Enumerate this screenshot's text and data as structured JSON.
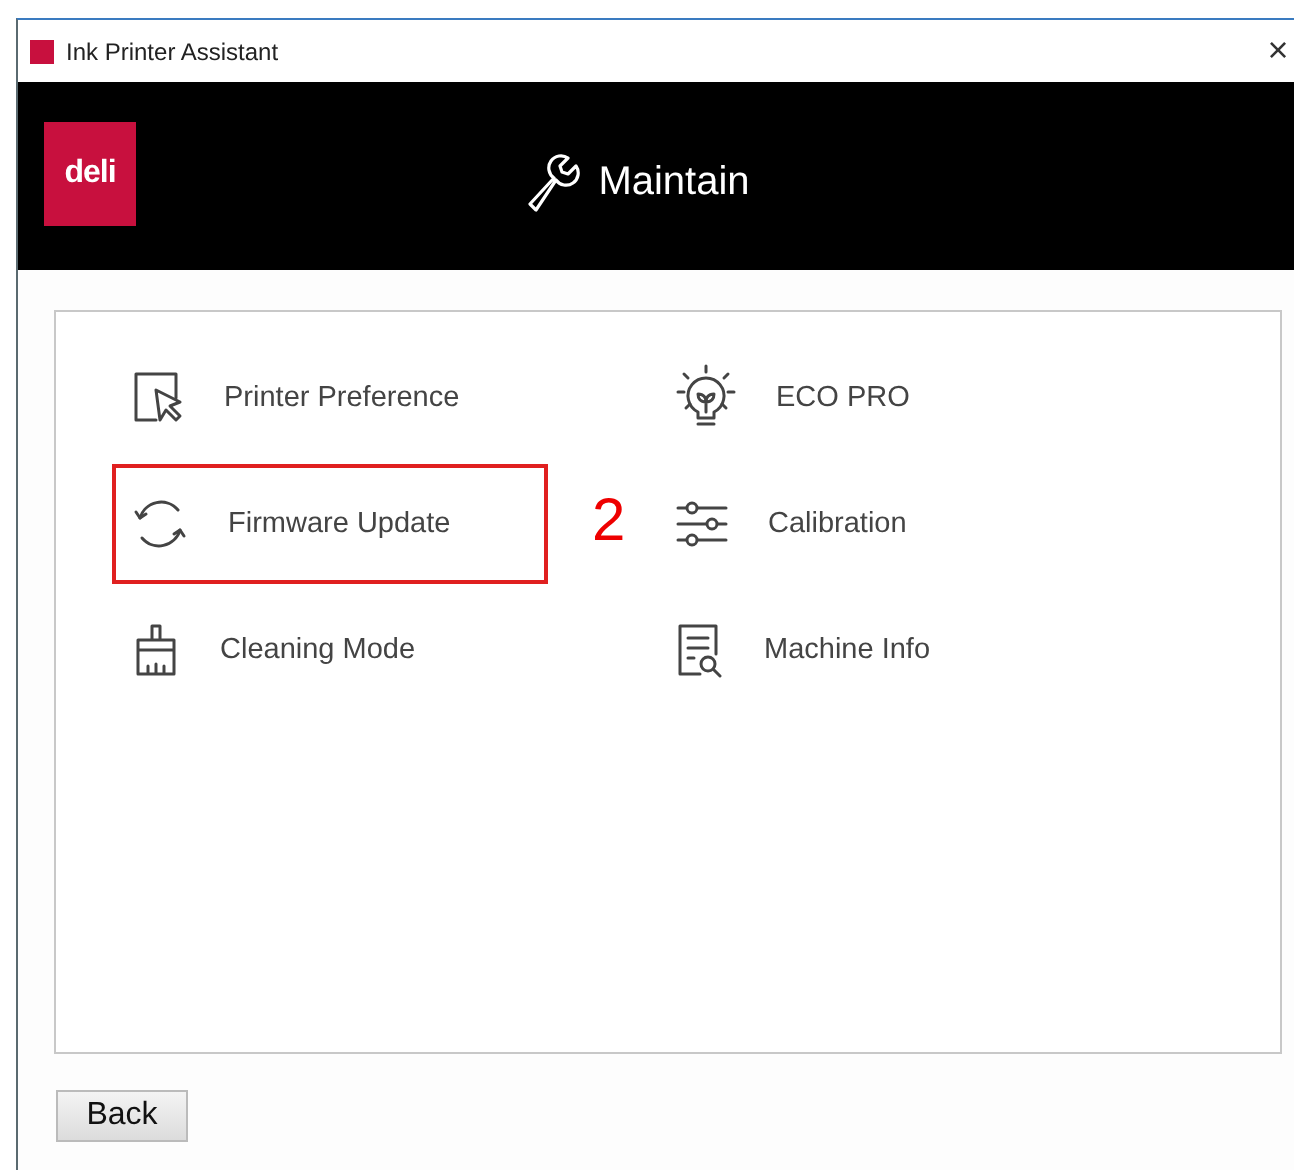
{
  "window": {
    "title": "Ink Printer Assistant",
    "close": "×"
  },
  "header": {
    "logo": "deli",
    "title": "Maintain"
  },
  "items": [
    {
      "kind": "preference",
      "label": "Printer Preference",
      "highlighted": false
    },
    {
      "kind": "eco",
      "label": "ECO PRO",
      "highlighted": false
    },
    {
      "kind": "update",
      "label": "Firmware Update",
      "highlighted": true
    },
    {
      "kind": "calibration",
      "label": "Calibration",
      "highlighted": false
    },
    {
      "kind": "cleaning",
      "label": "Cleaning Mode",
      "highlighted": false
    },
    {
      "kind": "info",
      "label": "Machine Info",
      "highlighted": false
    }
  ],
  "annotation": "2",
  "buttons": [
    "Back"
  ]
}
